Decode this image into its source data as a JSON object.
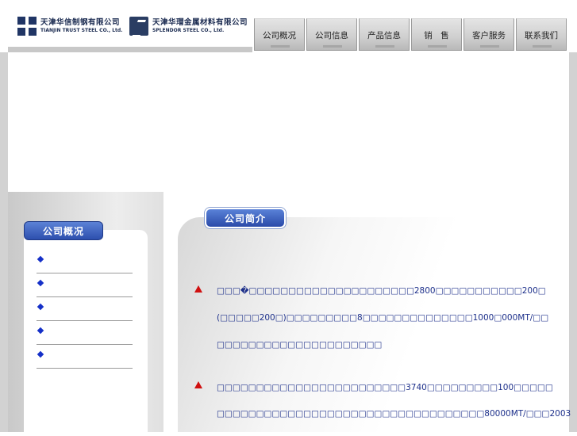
{
  "header": {
    "logo1": {
      "cn": "天津华信制钢有限公司",
      "en": "TIANJIN TRUST STEEL CO., Ltd."
    },
    "logo2": {
      "cn": "天津华瑁金属材料有限公司",
      "en": "SPLENDOR STEEL CO., Ltd."
    }
  },
  "nav": {
    "tabs": [
      {
        "label": "公司概况"
      },
      {
        "label": "公司信息"
      },
      {
        "label": "产品信息"
      },
      {
        "label": "销　售"
      },
      {
        "label": "客户服务"
      },
      {
        "label": "联系我们"
      }
    ]
  },
  "sidebar": {
    "title": "公司概况",
    "items": [
      {
        "label": ""
      },
      {
        "label": ""
      },
      {
        "label": ""
      },
      {
        "label": ""
      },
      {
        "label": ""
      }
    ]
  },
  "content": {
    "title": "公司简介",
    "paragraphs": [
      {
        "lines": [
          "□□□�□□□□□□□□□□□□□□□□□□□□□2800□□□□□□□□□□□200□",
          "(□□□□□200□)□□□□□□□□□8□□□□□□□□□□□□□□1000□000MT/□□",
          "□□□□□□□□□□□□□□□□□□□□□"
        ]
      },
      {
        "lines": [
          "□□□□□□□□□□□□□□□□□□□□□□□□3740□□□□□□□□□100□□□□□",
          "□□□□□□□□□□□□□□□□□□□□□□□□□□□□□□□□□□80000MT/□□□2003"
        ]
      }
    ]
  },
  "colors": {
    "accent": "#2d4fae",
    "text": "#1c2f8a",
    "marker": "#d01010"
  }
}
